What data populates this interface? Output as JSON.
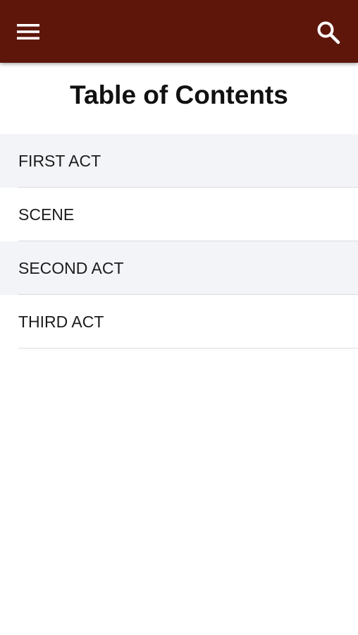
{
  "header": {
    "background_color": "#5e160b",
    "menu_icon": "hamburger-menu-icon",
    "search_icon": "search-icon"
  },
  "page": {
    "title": "Table of Contents"
  },
  "toc": {
    "items": [
      {
        "label": "FIRST ACT"
      },
      {
        "label": "SCENE"
      },
      {
        "label": "SECOND ACT"
      },
      {
        "label": "THIRD ACT"
      }
    ]
  }
}
